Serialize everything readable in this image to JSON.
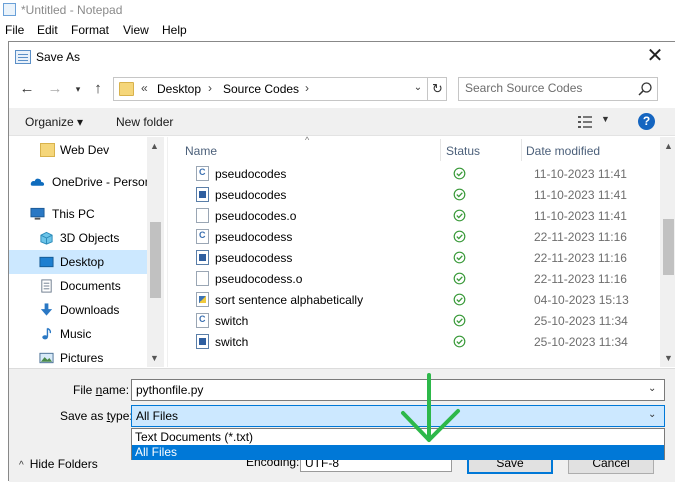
{
  "notepad": {
    "title": "*Untitled - Notepad",
    "menu": [
      "File",
      "Edit",
      "Format",
      "View",
      "Help"
    ]
  },
  "dialog": {
    "title": "Save As",
    "breadcrumb": {
      "prefix": "«",
      "items": [
        "Desktop",
        "Source Codes"
      ]
    },
    "search_placeholder": "Search Source Codes",
    "toolbar": {
      "organize": "Organize ▾",
      "new_folder": "New folder",
      "help": "?"
    },
    "nav_items": [
      {
        "label": "Web Dev",
        "icon": "folder-icon"
      },
      {
        "label": "OneDrive - Person",
        "icon": "cloud-icon"
      },
      {
        "label": "This PC",
        "icon": "computer-icon"
      },
      {
        "label": "3D Objects",
        "icon": "cube-icon"
      },
      {
        "label": "Desktop",
        "icon": "desktop-icon",
        "selected": true
      },
      {
        "label": "Documents",
        "icon": "document-icon"
      },
      {
        "label": "Downloads",
        "icon": "download-icon"
      },
      {
        "label": "Music",
        "icon": "music-icon"
      },
      {
        "label": "Pictures",
        "icon": "picture-icon"
      }
    ],
    "columns": {
      "name": "Name",
      "status": "Status",
      "date": "Date modified"
    },
    "files": [
      {
        "name": "pseudocodes",
        "type": "c",
        "date": "11-10-2023 11:41"
      },
      {
        "name": "pseudocodes",
        "type": "exe",
        "date": "11-10-2023 11:41"
      },
      {
        "name": "pseudocodes.o",
        "type": "o",
        "date": "11-10-2023 11:41"
      },
      {
        "name": "pseudocodess",
        "type": "c",
        "date": "22-11-2023 11:16"
      },
      {
        "name": "pseudocodess",
        "type": "exe",
        "date": "22-11-2023 11:16"
      },
      {
        "name": "pseudocodess.o",
        "type": "o",
        "date": "22-11-2023 11:16"
      },
      {
        "name": "sort sentence alphabetically",
        "type": "py",
        "date": "04-10-2023 15:13"
      },
      {
        "name": "switch",
        "type": "c",
        "date": "25-10-2023 11:34"
      },
      {
        "name": "switch",
        "type": "exe",
        "date": "25-10-2023 11:34"
      }
    ],
    "file_name_label_pre": "File ",
    "file_name_label_u": "n",
    "file_name_label_post": "ame:",
    "file_name_value": "pythonfile.py",
    "save_type_label_pre": "Save as ",
    "save_type_label_u": "t",
    "save_type_label_post": "ype:",
    "save_type_value": "All Files",
    "save_type_options": [
      "Text Documents (*.txt)",
      "All Files"
    ],
    "hide_folders": "Hide Folders",
    "encoding_label": "Encoding:",
    "encoding_value": "UTF-8",
    "save_button": "Save",
    "cancel_button": "Cancel"
  },
  "colors": {
    "accent": "#0078d7",
    "selection": "#cce8ff",
    "annotation_arrow": "#2db84a",
    "status_ok": "#3a9a3a"
  }
}
